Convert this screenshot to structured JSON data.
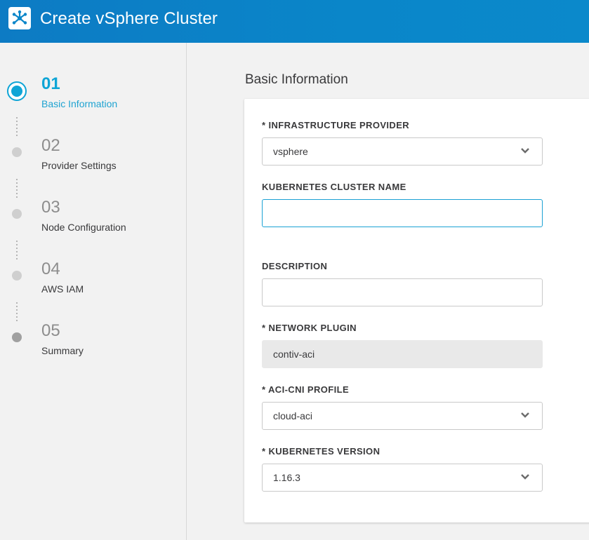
{
  "header": {
    "title": "Create vSphere Cluster",
    "logo_icon": "asterisk-logo-icon"
  },
  "sidebar": {
    "steps": [
      {
        "number": "01",
        "label": "Basic Information"
      },
      {
        "number": "02",
        "label": "Provider Settings"
      },
      {
        "number": "03",
        "label": "Node Configuration"
      },
      {
        "number": "04",
        "label": "AWS IAM"
      },
      {
        "number": "05",
        "label": "Summary"
      }
    ]
  },
  "main": {
    "section_title": "Basic Information",
    "fields": {
      "provider": {
        "label": "* INFRASTRUCTURE PROVIDER",
        "value": "vsphere"
      },
      "cluster_name": {
        "label": "KUBERNETES CLUSTER NAME",
        "value": ""
      },
      "description": {
        "label": "DESCRIPTION",
        "value": ""
      },
      "network_plugin": {
        "label": "* NETWORK PLUGIN",
        "value": "contiv-aci"
      },
      "aci_profile": {
        "label": "* ACI-CNI PROFILE",
        "value": "cloud-aci"
      },
      "k8s_version": {
        "label": "* KUBERNETES VERSION",
        "value": "1.16.3"
      }
    }
  },
  "colors": {
    "header": "#0b86c9",
    "accent": "#0fa5d6"
  }
}
